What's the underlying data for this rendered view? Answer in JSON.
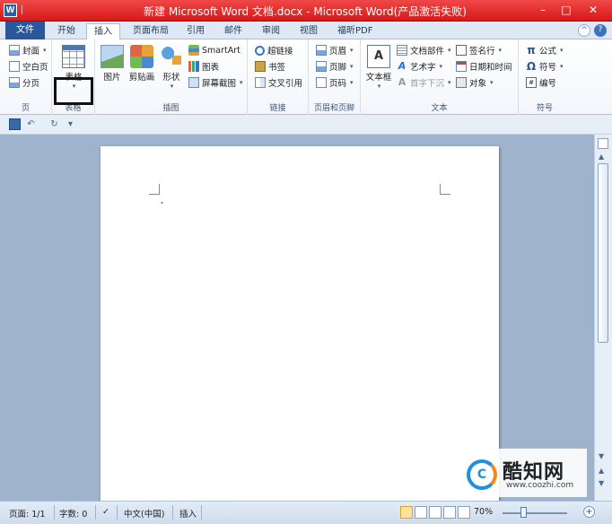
{
  "window": {
    "title": "新建 Microsoft Word 文档.docx - Microsoft Word(产品激活失败)",
    "app_logo": "W",
    "accent_color": "#e02020",
    "controls": {
      "minimize": "–",
      "restore": "□",
      "close": "✕"
    }
  },
  "tabs": {
    "file": "文件",
    "items": [
      "开始",
      "插入",
      "页面布局",
      "引用",
      "邮件",
      "审阅",
      "视图",
      "福昕PDF"
    ],
    "active": "插入",
    "help_icon": "?",
    "collapse_icon": "^"
  },
  "ribbon": {
    "pages": {
      "label": "页",
      "items": [
        "封面",
        "空白页",
        "分页"
      ]
    },
    "tables": {
      "label": "表格",
      "button": "表格"
    },
    "illustrations": {
      "label": "插图",
      "picture": "图片",
      "clipart": "剪贴画",
      "shapes": "形状",
      "small": [
        "SmartArt",
        "图表",
        "屏幕截图"
      ]
    },
    "links": {
      "label": "链接",
      "items": [
        "超链接",
        "书签",
        "交叉引用"
      ]
    },
    "header_footer": {
      "label": "页眉和页脚",
      "items": [
        "页眉",
        "页脚",
        "页码"
      ]
    },
    "text": {
      "label": "文本",
      "textbox": "文本框",
      "col1": [
        "文档部件",
        "艺术字",
        "首字下沉"
      ],
      "col2": [
        "签名行",
        "日期和时间",
        "对象"
      ]
    },
    "symbols": {
      "label": "符号",
      "items": [
        "公式",
        "符号",
        "编号"
      ],
      "glyphs": [
        "π",
        "Ω",
        "#"
      ]
    }
  },
  "qat": {
    "undo": "↶",
    "redo": "↻",
    "more": "▾"
  },
  "status": {
    "page": "页面: 1/1",
    "words": "字数: 0",
    "language": "中文(中国)",
    "mode": "插入",
    "zoom": "70%",
    "zoom_value": 70
  },
  "watermark": {
    "name": "酷知网",
    "url": "www.coozhi.com",
    "logo_letter": "C"
  }
}
